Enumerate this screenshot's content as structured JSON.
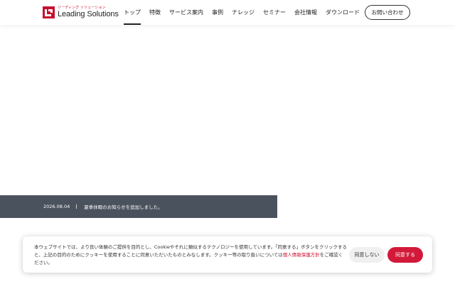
{
  "brand": {
    "kana": "リーディング ソリューション",
    "name": "Leading Solutions",
    "accent_color": "#c8102e"
  },
  "nav": {
    "items": [
      {
        "label": "トップ",
        "active": true
      },
      {
        "label": "特徴"
      },
      {
        "label": "サービス案内"
      },
      {
        "label": "事例"
      },
      {
        "label": "ナレッジ"
      },
      {
        "label": "セミナー"
      },
      {
        "label": "会社情報"
      },
      {
        "label": "ダウンロード"
      }
    ],
    "contact_label": "お問い合わせ"
  },
  "news": {
    "date": "2026.08.04",
    "text": "夏季休暇のお知らせを追加しました。",
    "bar_color": "#4a525d"
  },
  "cookie": {
    "text_before": "本ウェブサイトでは、より良い体験のご提供を目的とし、Cookieやそれに類似するテクノロジーを使用しています。「同意する」ボタンをクリックすると、上記の目的のためにクッキーを使用することに同意いただいたものとみなします。クッキー等の取り扱いについては",
    "link_text": "個人情報保護方針",
    "text_after": "をご確認ください。",
    "decline_label": "同意しない",
    "accept_label": "同意する",
    "accept_color": "#d2193a"
  }
}
